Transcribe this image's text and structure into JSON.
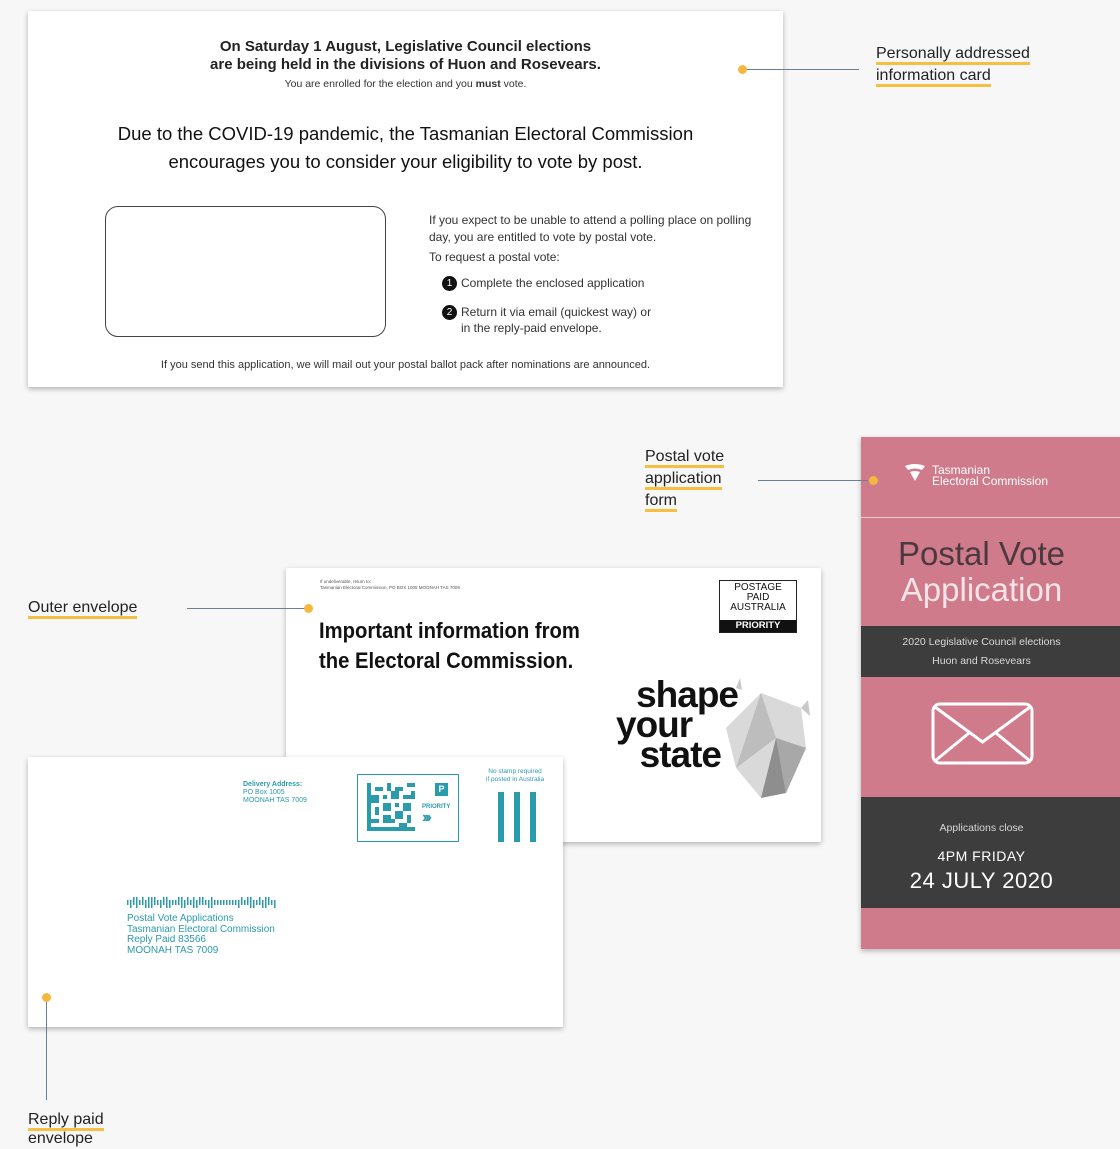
{
  "info_card": {
    "headline_line1": "On Saturday 1 August, Legislative Council elections",
    "headline_line2": "are being held in the divisions of Huon and Rosevears.",
    "enrolled_pre": "You are enrolled for the election and you ",
    "enrolled_bold": "must",
    "enrolled_post": " vote.",
    "covid_line1": "Due to the COVID-19 pandemic, the Tasmanian Electoral Commission",
    "covid_line2": "encourages you to consider your eligibility to vote by post.",
    "right_text": "If you expect to be unable to attend a polling place on polling day, you are entitled to vote by postal vote.",
    "request": "To request a postal vote:",
    "steps": [
      {
        "num": "1",
        "text": "Complete the enclosed application"
      },
      {
        "num": "2",
        "text": "Return it via email (quickest way) or in the reply-paid envelope."
      }
    ],
    "footer": "If you send this application, we will mail out your postal ballot pack after nominations are announced."
  },
  "labels": {
    "info_card_l1": "Personally addressed",
    "info_card_l2": "information card",
    "postal_form_l1": "Postal vote",
    "postal_form_l2": "application",
    "postal_form_l3": "form",
    "outer_envelope": "Outer envelope",
    "reply_l1": "Reply paid",
    "reply_l2": "envelope"
  },
  "outer_envelope": {
    "return_l1": "If undeliverable, return to:",
    "return_l2": "Tasmanian Electoral Commission, PO BOX 1005 MOONAH TAS 7009",
    "headline_l1": "Important information from",
    "headline_l2": "the Electoral Commission.",
    "postage_l1": "POSTAGE",
    "postage_l2": "PAID",
    "postage_l3": "AUSTRALIA",
    "postage_priority": "PRIORITY",
    "slogan_l1": "shape",
    "slogan_l2": "your",
    "slogan_l3": "state"
  },
  "reply_envelope": {
    "delivery_title": "Delivery Address:",
    "delivery_l1": "PO Box 1005",
    "delivery_l2": "MOONAH  TAS  7009",
    "priority": "PRIORITY",
    "no_stamp_l1": "No stamp required",
    "no_stamp_l2": "if posted in Australia",
    "addr_l1": "Postal Vote Applications",
    "addr_l2": "Tasmanian Electoral Commission",
    "addr_l3": "Reply Paid 83566",
    "addr_l4": "MOONAH  TAS  7009",
    "accent_color": "#2a9bab"
  },
  "postal_form": {
    "brand_l1": "Tasmanian",
    "brand_l2": "Electoral Commission",
    "title_l1": "Postal Vote",
    "title_l2": "Application",
    "election_l1": "2020 Legislative Council elections",
    "election_l2": "Huon and Rosevears",
    "close_label": "Applications close",
    "close_time": "4PM FRIDAY",
    "close_date": "24 JULY 2020",
    "bg_color": "#cf7b8c",
    "band_color": "#3d3d3d",
    "icon": "envelope-icon"
  }
}
